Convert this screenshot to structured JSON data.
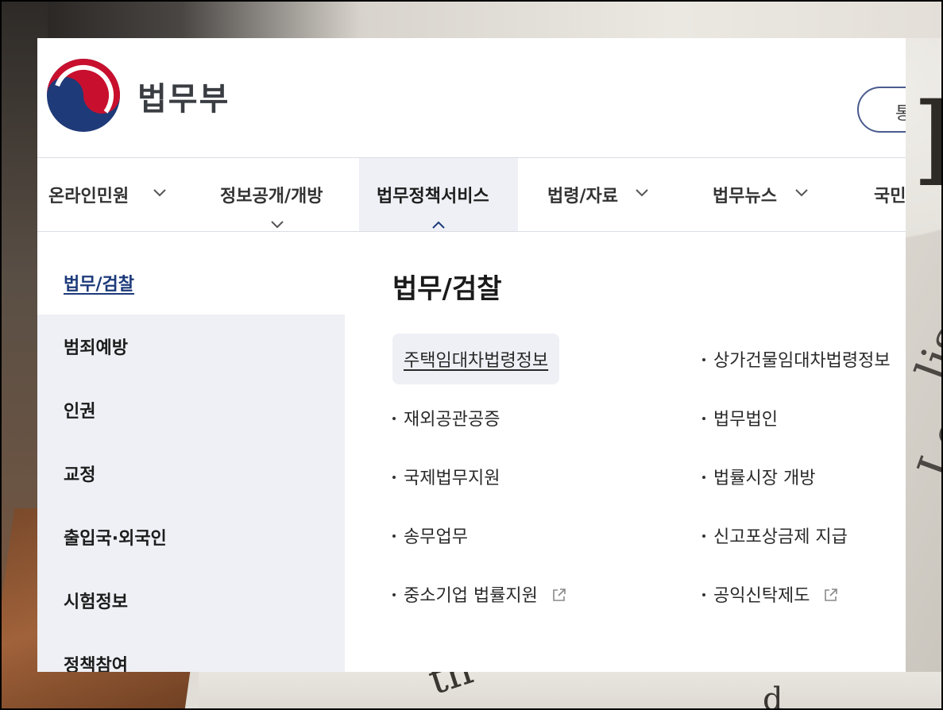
{
  "header": {
    "logo_text": "법무부",
    "right_button_label": "통"
  },
  "gnb": {
    "items": [
      {
        "label": "온라인민원"
      },
      {
        "label": "정보공개/개방"
      },
      {
        "label": "법무정책서비스"
      },
      {
        "label": "법령/자료"
      },
      {
        "label": "법무뉴스"
      },
      {
        "label": "국민"
      }
    ]
  },
  "sidebar": {
    "items": [
      {
        "label": "법무/검찰"
      },
      {
        "label": "범죄예방"
      },
      {
        "label": "인권"
      },
      {
        "label": "교정"
      },
      {
        "label": "출입국·외국인"
      },
      {
        "label": "시험정보"
      },
      {
        "label": "정책참여"
      }
    ]
  },
  "content": {
    "title": "법무/검찰",
    "links": [
      {
        "label": "주택임대차법령정보"
      },
      {
        "label": "상가건물임대차법령정보"
      },
      {
        "label": "재외공관공증"
      },
      {
        "label": "법무법인"
      },
      {
        "label": "국제법무지원"
      },
      {
        "label": "법률시장 개방"
      },
      {
        "label": "송무업무"
      },
      {
        "label": "신고포상금제 지급"
      },
      {
        "label": "중소기업 법률지원"
      },
      {
        "label": "공익신탁제도"
      }
    ]
  },
  "colors": {
    "accent_navy": "#1c3a7a",
    "menu_bg": "#eef0f5",
    "emblem_red": "#c8102e",
    "emblem_blue": "#1f3a78"
  }
}
